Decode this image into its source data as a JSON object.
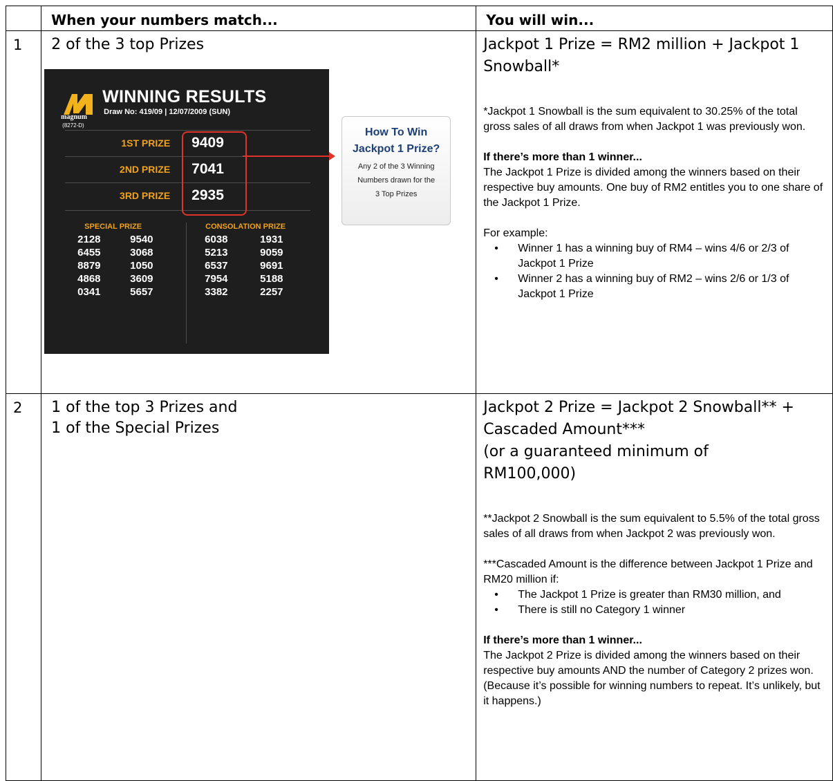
{
  "header": {
    "col_match": "When your numbers match...",
    "col_win": "You will win..."
  },
  "row1": {
    "num": "1",
    "match": "2 of the 3 top Prizes",
    "prize_title": "Jackpot 1 Prize = RM2 million + Jackpot 1 Snowball*",
    "snowball_note": "*Jackpot 1 Snowball is the sum equivalent to 30.25% of the total gross sales of all draws from when Jackpot 1 was previously won.",
    "more_winners_heading": "If there’s more than 1 winner...",
    "more_winners_text": "The Jackpot 1 Prize is divided among the winners based on their respective buy amounts. One buy of RM2 entitles you to one share of the Jackpot 1 Prize.",
    "example_label": "For example:",
    "examples": [
      "Winner 1 has a winning buy of RM4 – wins 4/6 or 2/3 of Jackpot 1 Prize",
      "Winner 2 has a winning buy of RM2 – wins 2/6 or 1/3 of Jackpot 1 Prize"
    ]
  },
  "figure": {
    "logo_text": "magnum",
    "logo_code": "(8272-D)",
    "title": "WINNING RESULTS",
    "draw_info": "Draw No: 419/09  |  12/07/2009 (SUN)",
    "top_prizes": [
      {
        "label": "1ST PRIZE",
        "number": "9409"
      },
      {
        "label": "2ND PRIZE",
        "number": "7041"
      },
      {
        "label": "3RD PRIZE",
        "number": "2935"
      }
    ],
    "special_label": "SPECIAL PRIZE",
    "consolation_label": "CONSOLATION PRIZE",
    "special_numbers": [
      "2128",
      "9540",
      "6455",
      "3068",
      "8879",
      "1050",
      "4868",
      "3609",
      "0341",
      "5657"
    ],
    "consolation_numbers": [
      "6038",
      "1931",
      "5213",
      "9059",
      "6537",
      "9691",
      "7954",
      "5188",
      "3382",
      "2257"
    ],
    "how_title_line1": "How To Win",
    "how_title_line2": "Jackpot 1 Prize?",
    "how_body_lines": [
      "Any 2 of the 3 Winning",
      "Numbers drawn for the",
      "3 Top Prizes"
    ],
    "colors": {
      "panel": "#1e1e1e",
      "orange": "#f0a21e",
      "red": "#e0342a",
      "how_title": "#1c3f75"
    }
  },
  "row2": {
    "num": "2",
    "match_line1": "1 of the top 3 Prizes and",
    "match_line2": "1 of the Special Prizes",
    "prize_title_line1": "Jackpot 2 Prize = Jackpot 2 Snowball** +",
    "prize_title_line2": "Cascaded Amount***",
    "prize_title_line3": "(or a guaranteed minimum of",
    "prize_title_line4": "RM100,000)",
    "snowball_note": "**Jackpot 2 Snowball is the sum equivalent to 5.5% of the total gross sales of all draws from when Jackpot 2 was previously won.",
    "cascade_note": "***Cascaded Amount is the difference between Jackpot 1 Prize and RM20 million if:",
    "conditions": [
      "The Jackpot 1 Prize is greater than RM30 million, and",
      "There is still no Category 1 winner"
    ],
    "more_winners_heading": "If there’s more than 1 winner...",
    "more_winners_text": "The Jackpot 2 Prize is divided among the winners based on their respective buy amounts AND the number of Category 2 prizes won. (Because it’s possible for winning numbers to repeat. It’s unlikely, but it happens.)"
  }
}
